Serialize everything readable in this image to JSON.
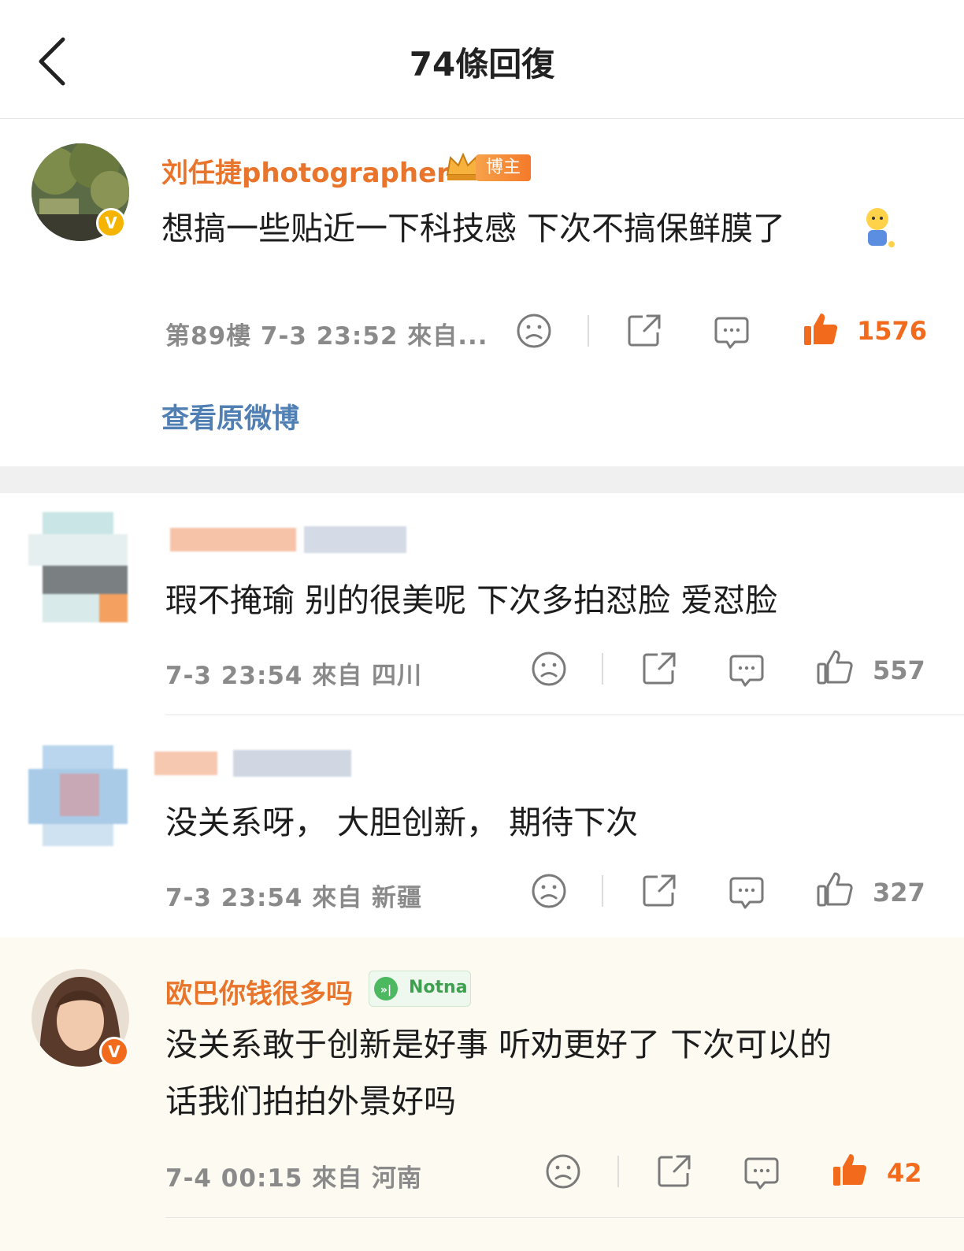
{
  "header": {
    "title": "74條回復",
    "back_icon": "chevron-left-icon"
  },
  "main_comment": {
    "username": "刘任捷photographer",
    "badge": "博主",
    "text": "想搞一些贴近一下科技感 下次不搞保鲜膜了",
    "meta": "第89樓 7-3 23:52 來自...",
    "likes": "1576",
    "liked": true,
    "view_original": "查看原微博"
  },
  "replies": [
    {
      "text": "瑕不掩瑜 别的很美呢 下次多拍怼脸 爱怼脸",
      "meta": "7-3 23:54 來自 四川",
      "likes": "557",
      "liked": false
    },
    {
      "text": "没关系呀， 大胆创新， 期待下次",
      "meta": "7-3 23:54 來自 新疆",
      "likes": "327",
      "liked": false
    },
    {
      "username": "欧巴你钱很多吗",
      "badge": "Notna",
      "text_line1": "没关系敢于创新是好事 听劝更好了 下次可以的",
      "text_line2": "话我们拍拍外景好吗",
      "meta": "7-4 00:15 來自 河南",
      "likes": "42",
      "liked": true
    }
  ],
  "colors": {
    "accent": "#f26b1d",
    "username": "#e8752b",
    "link": "#4f7fb3",
    "meta": "#8a8a8a"
  }
}
